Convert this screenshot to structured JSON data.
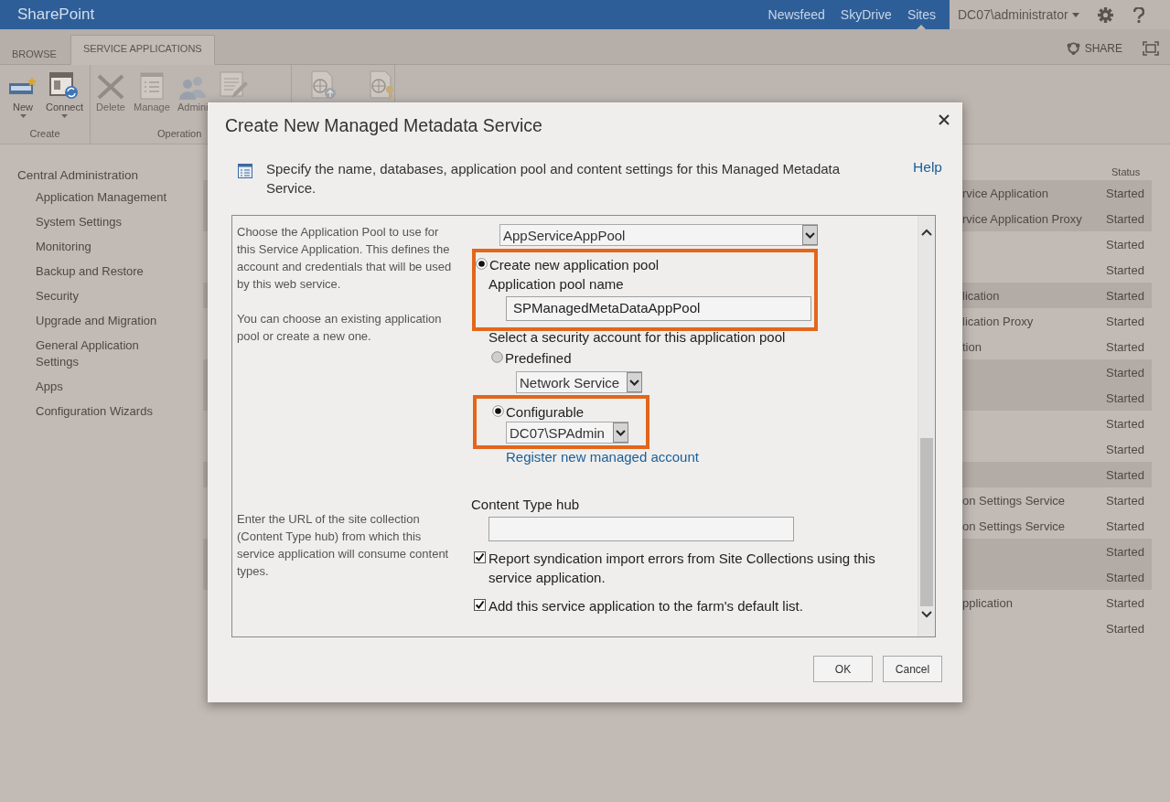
{
  "top_bar": {
    "brand": "SharePoint",
    "links": [
      {
        "label": "Newsfeed",
        "selected": false
      },
      {
        "label": "SkyDrive",
        "selected": false
      },
      {
        "label": "Sites",
        "selected": true
      }
    ],
    "user": "DC07\\administrator"
  },
  "ribbon": {
    "tabs": [
      {
        "label": "BROWSE",
        "selected": false
      },
      {
        "label": "SERVICE APPLICATIONS",
        "selected": true
      }
    ],
    "share": "SHARE",
    "groups": [
      {
        "label": "Create",
        "buttons": [
          {
            "kind": "new",
            "label": "New",
            "dropdown": true,
            "disabled": false
          },
          {
            "kind": "connect",
            "label": "Connect",
            "dropdown": true,
            "disabled": false
          }
        ]
      },
      {
        "label": "Operation",
        "buttons": [
          {
            "kind": "delete",
            "label": "Delete",
            "disabled": true
          },
          {
            "kind": "manage",
            "label": "Manage",
            "disabled": true
          },
          {
            "kind": "admins",
            "label": "Admini",
            "disabled": true
          },
          {
            "kind": "properties",
            "disabled": true
          }
        ]
      },
      {
        "buttons": [
          {
            "kind": "publish",
            "disabled": true
          },
          {
            "kind": "permissions",
            "disabled": true
          }
        ]
      }
    ]
  },
  "sidebar": {
    "title": "Central Administration",
    "items": [
      "Application Management",
      "System Settings",
      "Monitoring",
      "Backup and Restore",
      "Security",
      "Upgrade and Migration",
      "General Application Settings",
      "Apps",
      "Configuration Wizards"
    ]
  },
  "list": {
    "status_header": "Status",
    "rows": [
      {
        "name": "rvice Application",
        "status": "Started",
        "shaded": true
      },
      {
        "name": "rvice Application Proxy",
        "status": "Started",
        "shaded": true
      },
      {
        "status": "Started",
        "shaded": false
      },
      {
        "status": "Started",
        "shaded": false
      },
      {
        "name": "lication",
        "status": "Started",
        "shaded": true
      },
      {
        "name": "lication Proxy",
        "status": "Started",
        "shaded": false
      },
      {
        "name": "tion",
        "status": "Started",
        "shaded": false
      },
      {
        "status": "Started",
        "shaded": true
      },
      {
        "status": "Started",
        "shaded": true
      },
      {
        "status": "Started",
        "shaded": false
      },
      {
        "status": "Started",
        "shaded": false
      },
      {
        "status": "Started",
        "shaded": true
      },
      {
        "name": "on Settings Service",
        "status": "Started",
        "shaded": false
      },
      {
        "name": "on Settings Service",
        "status": "Started",
        "shaded": false
      },
      {
        "status": "Started",
        "shaded": true
      },
      {
        "status": "Started",
        "shaded": true
      },
      {
        "name": "pplication",
        "status": "Started",
        "shaded": false
      },
      {
        "status": "Started",
        "shaded": false
      }
    ]
  },
  "dialog": {
    "title": "Create New Managed Metadata Service",
    "intro": "Specify the name, databases, application pool and content settings for this Managed Metadata Service.",
    "help": "Help",
    "pool_section": {
      "description": [
        "Choose the Application Pool to use for this Service Application.  This defines the account and credentials that will be used by this web service.",
        "You can choose an existing application pool or create a new one."
      ],
      "existing_pool": "AppServiceAppPool",
      "create_new": {
        "label": "Create new application pool",
        "selected": true
      },
      "pool_name_label": "Application pool name",
      "pool_name": "SPManagedMetaDataAppPool",
      "security_label": "Select a security account for this application pool",
      "predefined": {
        "label": "Predefined",
        "selected": false
      },
      "predefined_account": "Network Service",
      "configurable": {
        "label": "Configurable",
        "selected": true
      },
      "configurable_account": "DC07\\SPAdmin",
      "register_link": "Register new managed account"
    },
    "hub_section": {
      "description": "Enter the URL of the site collection (Content Type hub) from which this service application will consume content types.",
      "label": "Content Type hub",
      "options": [
        {
          "label": "Report syndication import errors from Site Collections using this service application.",
          "checked": true
        },
        {
          "label": "Add this service application to the farm's default list.",
          "checked": true
        }
      ]
    },
    "buttons": [
      "OK",
      "Cancel"
    ]
  }
}
